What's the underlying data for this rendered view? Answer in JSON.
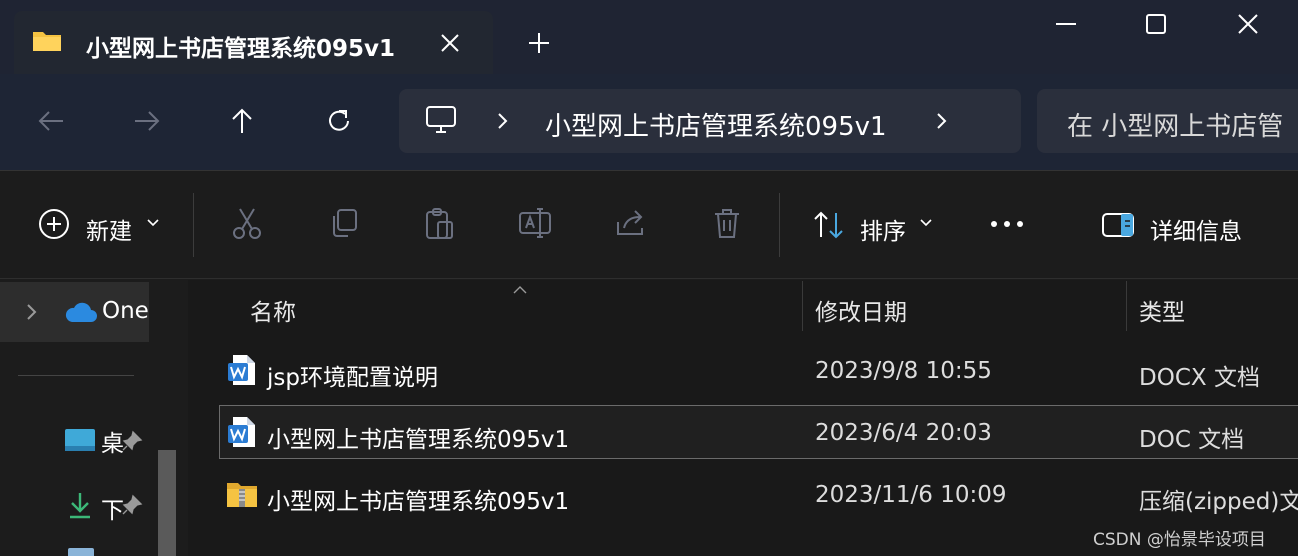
{
  "window": {
    "tab_title": "小型网上书店管理系统095v1"
  },
  "address": {
    "path_segment": "小型网上书店管理系统095v1",
    "search_placeholder": "在 小型网上书店管"
  },
  "toolbar": {
    "new_label": "新建",
    "sort_label": "排序",
    "details_label": "详细信息"
  },
  "sidebar": {
    "items": [
      {
        "label": "One",
        "icon": "cloud-icon"
      },
      {
        "label": "桌",
        "icon": "desktop-icon"
      },
      {
        "label": "下",
        "icon": "download-icon"
      }
    ]
  },
  "filelist": {
    "columns": [
      "名称",
      "修改日期",
      "类型"
    ],
    "rows": [
      {
        "name": "jsp环境配置说明",
        "date": "2023/9/8 10:55",
        "type": "DOCX 文档",
        "icon": "word-doc-icon"
      },
      {
        "name": "小型网上书店管理系统095v1",
        "date": "2023/6/4 20:03",
        "type": "DOC 文档",
        "icon": "word-doc-icon"
      },
      {
        "name": "小型网上书店管理系统095v1",
        "date": "2023/11/6 10:09",
        "type": "压缩(zipped)文",
        "icon": "zip-folder-icon"
      }
    ]
  },
  "watermark": "CSDN @怡景毕设项目",
  "colors": {
    "accent": "#4aa8e0",
    "word_blue": "#2b7cd3",
    "folder_yellow": "#f5c342"
  }
}
